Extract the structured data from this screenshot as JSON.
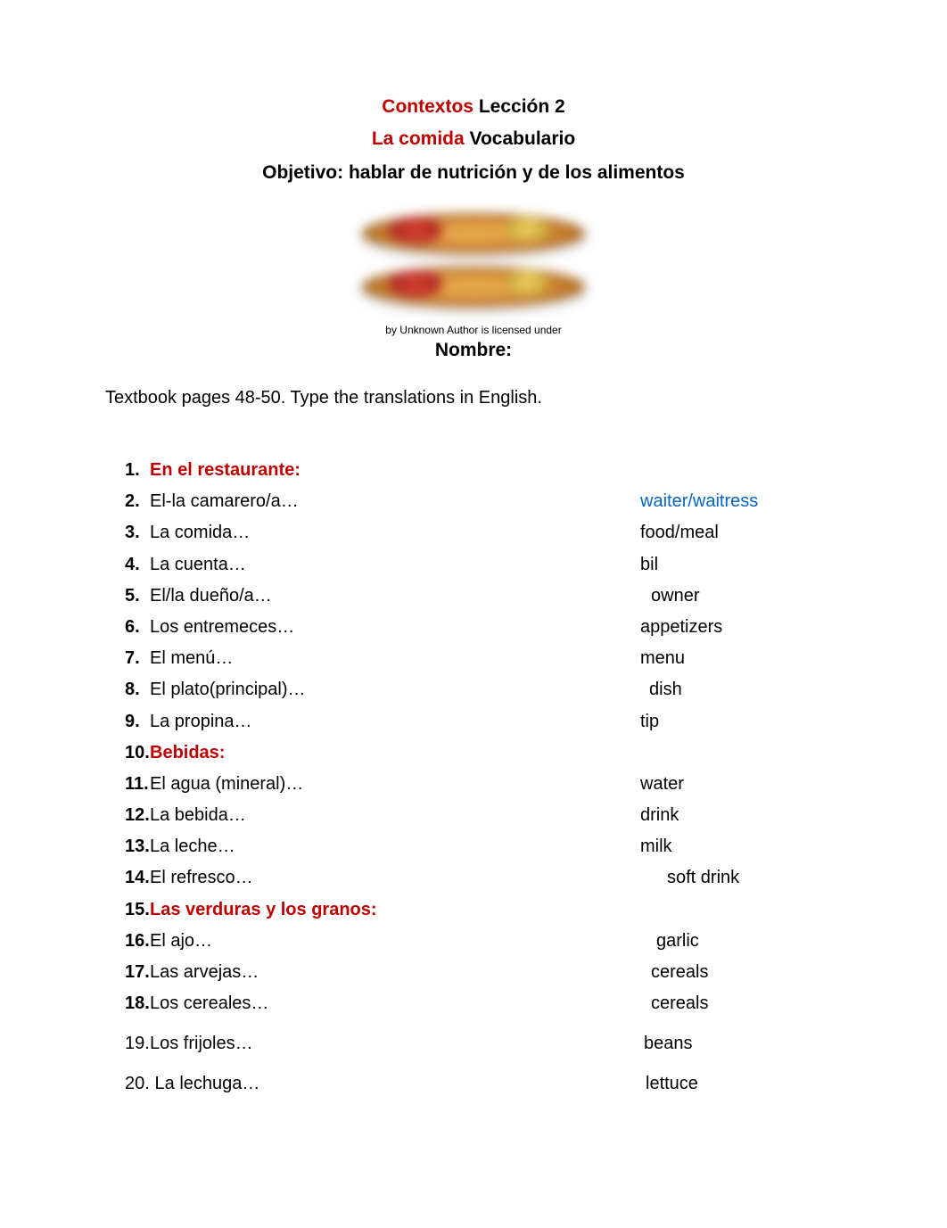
{
  "header": {
    "line1_red": "Contextos",
    "line1_black": "Lección 2",
    "line2_red": "La comida",
    "line2_black": "Vocabulario",
    "line3_black": "Objetivo: hablar de nutrición y de los alimentos"
  },
  "caption": "by Unknown Author is licensed under",
  "nombre_label": "Nombre:",
  "instruction": "Textbook pages 48-50. Type the translations in English.",
  "items": [
    {
      "num": "1.",
      "term": "En el restaurante:",
      "trans": "",
      "is_header": true,
      "style": "n1-9"
    },
    {
      "num": "2.",
      "term": "El-la camarero/a…",
      "trans": "waiter/waitress",
      "trans_class": "blue-link",
      "style": "n1-9"
    },
    {
      "num": "3.",
      "term": "La comida…",
      "trans": "food/meal",
      "style": "n1-9"
    },
    {
      "num": "4.",
      "term": "La cuenta…",
      "trans": "bil",
      "style": "n1-9"
    },
    {
      "num": "5.",
      "term": "El/la dueño/a…",
      "trans": "owner",
      "style": "n1-9",
      "trans_pad": "12"
    },
    {
      "num": "6.",
      "term": "Los entremeces…",
      "trans": "appetizers",
      "style": "n1-9"
    },
    {
      "num": "7.",
      "term": "El menú…",
      "trans": "menu",
      "style": "n1-9"
    },
    {
      "num": "8.",
      "term": "El plato(principal)…",
      "trans": "dish",
      "style": "n1-9",
      "trans_pad": "10"
    },
    {
      "num": "9.",
      "term": "La propina…",
      "trans": "tip",
      "style": "n1-9"
    },
    {
      "num": "10.",
      "term": "Bebidas:",
      "trans": "",
      "is_header": true,
      "style": "n10p"
    },
    {
      "num": "11.",
      "term": "El agua (mineral)…",
      "trans": "water",
      "style": "n10p"
    },
    {
      "num": "12.",
      "term": "La bebida…",
      "trans": "drink",
      "style": "n10p"
    },
    {
      "num": "13.",
      "term": "La leche…",
      "trans": "milk",
      "style": "n10p"
    },
    {
      "num": "14.",
      "term": "El refresco…",
      "trans": "soft drink",
      "style": "n10p",
      "trans_pad": "30"
    },
    {
      "num": "15.",
      "term": "Las verduras y los granos:",
      "trans": "",
      "is_header": true,
      "style": "n10p"
    },
    {
      "num": "16.",
      "term": "El ajo…",
      "trans": "garlic",
      "style": "n10p",
      "trans_pad": "18"
    },
    {
      "num": "17.",
      "term": "Las arvejas…",
      "trans": "cereals",
      "style": "n10p",
      "trans_pad": "12"
    },
    {
      "num": "18.",
      "term": "Los cereales…",
      "trans": "cereals",
      "style": "n10p",
      "trans_pad": "12"
    },
    {
      "num": "19.",
      "term": "Los frijoles…",
      "trans": "beans",
      "style": "n10p",
      "spaced_top": true,
      "nonbold_num": true,
      "trans_pad": "4"
    },
    {
      "num": "20.",
      "term": " La lechuga…",
      "trans": "lettuce",
      "style": "n10p",
      "spaced_top": true,
      "nonbold_num": true,
      "trans_pad": "6"
    }
  ]
}
